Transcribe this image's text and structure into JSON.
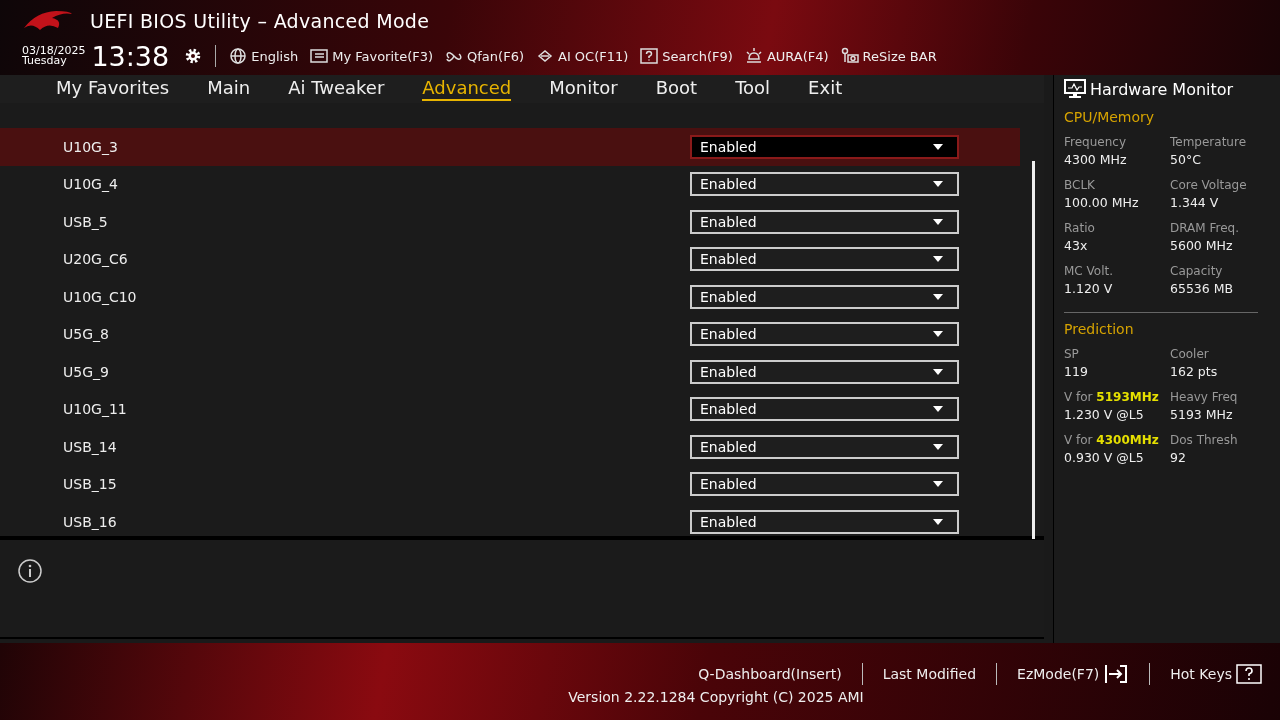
{
  "window": {
    "title": "UEFI BIOS Utility – Advanced Mode"
  },
  "clock": {
    "date": "03/18/2025",
    "day": "Tuesday",
    "time": "13:38"
  },
  "toolbar": [
    {
      "kind": "globe",
      "label": "English"
    },
    {
      "kind": "favorite",
      "label": "My Favorite(F3)"
    },
    {
      "kind": "fan",
      "label": "Qfan(F6)"
    },
    {
      "kind": "chip",
      "label": "AI OC(F11)"
    },
    {
      "kind": "search",
      "label": "Search(F9)"
    },
    {
      "kind": "aura",
      "label": "AURA(F4)"
    },
    {
      "kind": "resize",
      "label": "ReSize BAR"
    }
  ],
  "tabs": [
    {
      "label": "My Favorites",
      "selected": false
    },
    {
      "label": "Main",
      "selected": false
    },
    {
      "label": "Ai Tweaker",
      "selected": false
    },
    {
      "label": "Advanced",
      "selected": true
    },
    {
      "label": "Monitor",
      "selected": false
    },
    {
      "label": "Boot",
      "selected": false
    },
    {
      "label": "Tool",
      "selected": false
    },
    {
      "label": "Exit",
      "selected": false
    }
  ],
  "settings": [
    {
      "name": "U10G_3",
      "value": "Enabled",
      "selected": true
    },
    {
      "name": "U10G_4",
      "value": "Enabled",
      "selected": false
    },
    {
      "name": "USB_5",
      "value": "Enabled",
      "selected": false
    },
    {
      "name": "U20G_C6",
      "value": "Enabled",
      "selected": false
    },
    {
      "name": "U10G_C10",
      "value": "Enabled",
      "selected": false
    },
    {
      "name": "U5G_8",
      "value": "Enabled",
      "selected": false
    },
    {
      "name": "U5G_9",
      "value": "Enabled",
      "selected": false
    },
    {
      "name": "U10G_11",
      "value": "Enabled",
      "selected": false
    },
    {
      "name": "USB_14",
      "value": "Enabled",
      "selected": false
    },
    {
      "name": "USB_15",
      "value": "Enabled",
      "selected": false
    },
    {
      "name": "USB_16",
      "value": "Enabled",
      "selected": false
    }
  ],
  "hardware_monitor": {
    "title": "Hardware Monitor",
    "sections": [
      {
        "title": "CPU/Memory",
        "items": [
          {
            "label": "Frequency",
            "value": "4300 MHz"
          },
          {
            "label": "Temperature",
            "value": "50°C"
          },
          {
            "label": "BCLK",
            "value": "100.00 MHz"
          },
          {
            "label": "Core Voltage",
            "value": "1.344 V"
          },
          {
            "label": "Ratio",
            "value": "43x"
          },
          {
            "label": "DRAM Freq.",
            "value": "5600 MHz"
          },
          {
            "label": "MC Volt.",
            "value": "1.120 V"
          },
          {
            "label": "Capacity",
            "value": "65536 MB"
          }
        ]
      },
      {
        "title": "Prediction",
        "items": [
          {
            "label": "SP",
            "value": "119"
          },
          {
            "label": "Cooler",
            "value": "162 pts"
          },
          {
            "label": "V for **5193MHz**",
            "value": "1.230 V @L5"
          },
          {
            "label": "Heavy Freq",
            "value": "5193 MHz"
          },
          {
            "label": "V for **4300MHz**",
            "value": "0.930 V @L5"
          },
          {
            "label": "Dos Thresh",
            "value": "92"
          }
        ]
      }
    ]
  },
  "footer": {
    "links": [
      {
        "kind": "text",
        "label": "Q-Dashboard(Insert)"
      },
      {
        "kind": "text",
        "label": "Last Modified"
      },
      {
        "kind": "exit",
        "label": "EzMode(F7)"
      },
      {
        "kind": "help",
        "label": "Hot Keys"
      }
    ],
    "version": "Version 2.22.1284 Copyright (C) 2025 AMI"
  }
}
